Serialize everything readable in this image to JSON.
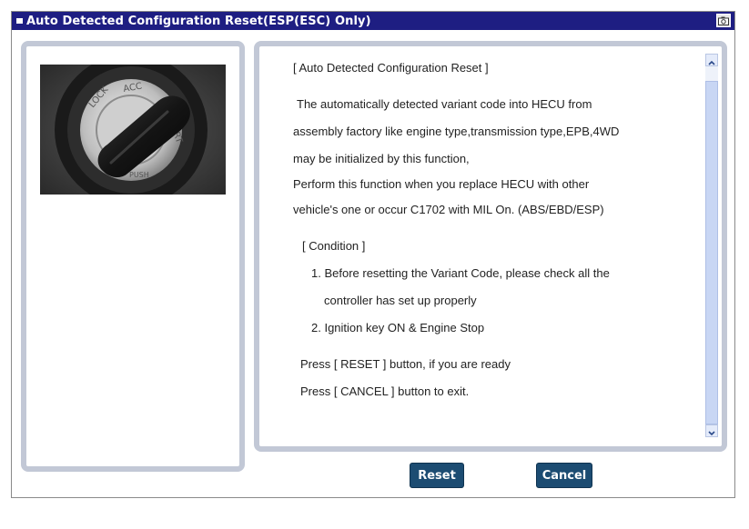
{
  "window": {
    "title": "Auto Detected Configuration Reset(ESP(ESC) Only)"
  },
  "image": {
    "label_lock": "LOCK",
    "label_acc": "ACC",
    "label_start": "START",
    "label_push": "PUSH"
  },
  "content": {
    "lines": [
      "[ Auto Detected Configuration Reset ]",
      "The automatically detected variant code into HECU from",
      "assembly factory like engine type,transmission type,EPB,4WD",
      "may be initialized by this function,",
      "Perform this function when you replace HECU with other",
      "vehicle's one or occur C1702 with MIL On. (ABS/EBD/ESP)",
      "[ Condition ]",
      "1. Before resetting the Variant Code, please check all the",
      "controller has set up properly",
      "2. Ignition key ON & Engine Stop",
      "Press  [ RESET ]  button, if you are ready",
      "Press  [ CANCEL ]  button to exit."
    ]
  },
  "buttons": {
    "reset": "Reset",
    "cancel": "Cancel"
  },
  "colors": {
    "titlebar": "#1e1e82",
    "panel_border": "#c2c8d6",
    "button": "#1c4c72"
  },
  "icons": {
    "title_bullet": "title-bullet-icon",
    "title_button": "camera-icon",
    "scroll_up": "chevron-up-icon",
    "scroll_down": "chevron-down-icon"
  }
}
